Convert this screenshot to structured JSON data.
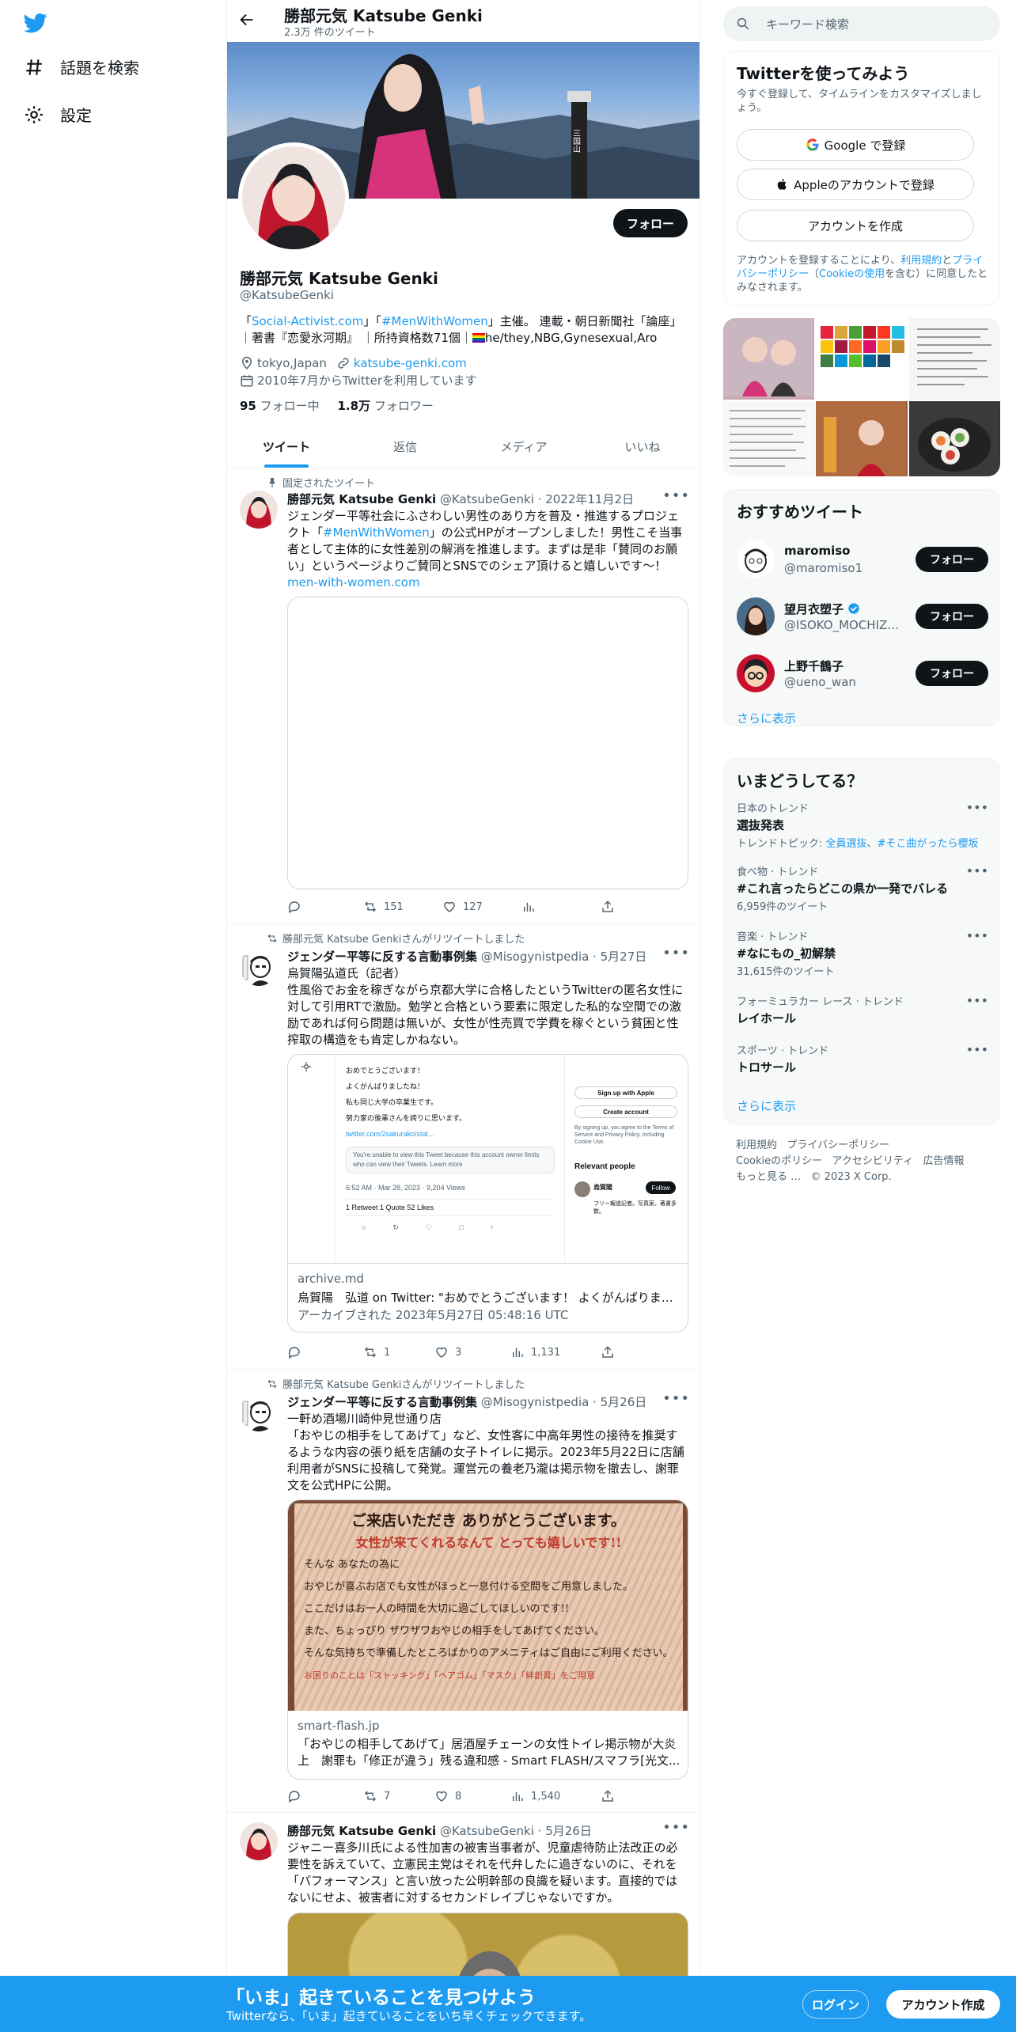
{
  "nav": {
    "explore": "話題を検索",
    "settings": "設定"
  },
  "header": {
    "title": "勝部元気 Katsube Genki",
    "subtitle": "2.3万 件のツイート"
  },
  "banner": {
    "sign_text": "三国山"
  },
  "profile": {
    "follow": "フォロー",
    "name": "勝部元気 Katsube Genki",
    "handle": "@KatsubeGenki",
    "bio_line1_a": "「",
    "bio_link1": "Social-Activist.com",
    "bio_line1_b": "」「",
    "bio_link2": "#MenWithWomen",
    "bio_line1_c": "」主催。 連載・朝日新聞社「論座」",
    "bio_line2": "｜著書『恋愛氷河期』 ｜所持資格数71個｜",
    "bio_line2_b": "he/they,NBG,Gynesexual,Aro",
    "location": "tokyo,Japan",
    "website": "katsube-genki.com",
    "joined": "2010年7月からTwitterを利用しています",
    "following_count": "95",
    "following_label": "フォロー中",
    "followers_count": "1.8万",
    "followers_label": "フォロワー"
  },
  "tabs": [
    "ツイート",
    "返信",
    "メディア",
    "いいね"
  ],
  "tweets": [
    {
      "context": "固定されたツイート",
      "name": "勝部元気 Katsube Genki",
      "handle": "@KatsubeGenki",
      "date": "· 2022年11月2日",
      "text_a": "ジェンダー平等社会にふさわしい男性のあり方を普及・推進するプロジェクト「",
      "text_link": "#MenWithWomen",
      "text_b": "」の公式HPがオープンしました！男性こそ当事者として主体的に女性差別の解消を推進します。まずは是非「賛同のお願い」というページよりご賛同とSNSでのシェア頂けると嬉しいです〜！",
      "url": "men-with-women.com",
      "reply": "",
      "retweets": "151",
      "likes": "127",
      "views": ""
    },
    {
      "context": "勝部元気 Katsube Genkiさんがリツイートしました",
      "name": "ジェンダー平等に反する言動事例集",
      "handle": "@Misogynistpedia",
      "date": "· 5月27日",
      "text": "烏賀陽弘道氏（記者）\n性風俗でお金を稼ぎながら京都大学に合格したというTwitterの匿名女性に対して引用RTで激励。勉学と合格という要素に限定した私的な空間での激励であれば何ら問題は無いが、女性が性売買で学費を稼ぐという貧困と性搾取の構造をも肯定しかねない。",
      "card_domain": "archive.md",
      "card_title": "烏賀陽　弘道 on Twitter: \"おめでとうございます！ よくがんばりまし...",
      "card_sub": "アーカイブされた 2023年5月27日 05:48:16 UTC",
      "shot_lines": [
        "おめでとうございます！",
        "よくがんばりましたね！",
        "私も同じ大学の卒業生です。",
        "努力家の後輩さんを誇りに思います。"
      ],
      "shot_link": "twitter.com/2sakurako/stat...",
      "shot_note": "You're unable to view this Tweet because this account owner limits who can view their Tweets. Learn more",
      "shot_time": "6:52 AM · Mar 28, 2023 · 9,204 Views",
      "shot_stats": "1 Retweet   1 Quote   52 Likes",
      "shot_apple": "Sign up with Apple",
      "shot_create": "Create account",
      "shot_terms": "By signing up, you agree to the Terms of Service and Privacy Policy, including Cookie Use.",
      "shot_relevant": "Relevant people",
      "shot_follow": "Follow",
      "shot_person": "烏賀陽",
      "shot_bio": "フリー報道記者。写真家。著書多数。",
      "retweets": "1",
      "likes": "3",
      "views": "1,131"
    },
    {
      "context": "勝部元気 Katsube Genkiさんがリツイートしました",
      "name": "ジェンダー平等に反する言動事例集",
      "handle": "@Misogynistpedia",
      "date": "· 5月26日",
      "text": "一軒め酒場川崎仲見世通り店\n「おやじの相手をしてあげて」など、女性客に中高年男性の接待を推奨するような内容の張り紙を店舗の女子トイレに掲示。2023年5月22日に店舗利用者がSNSに投稿して発覚。運営元の養老乃瀧は掲示物を撤去し、謝罪文を公式HPに公開。",
      "paper_lines": [
        "ご来店いただき ありがとうございます。",
        "女性が来てくれるなんて とっても嬉しいです!!",
        "そんな あなたの為に",
        "おやじが喜ぶお店でも女性がほっと一息付ける空間をご用意しました。",
        "ここだけはお一人の時間を大切に過ごしてほしいのです!!",
        "また、ちょっぴり ザワザワおやじの相手をしてあげてください。",
        "そんな気持ちで準備したところばかりのアメニティはご自由にご利用ください。",
        "お困りのことは「ストッキング」「ヘアゴム」「マスク」「絆創膏」をご用意"
      ],
      "card_domain": "smart-flash.jp",
      "card_title": "「おやじの相手してあげて」居酒屋チェーンの女性トイレ掲示物が大炎上　謝罪も「修正が違う」残る違和感 - Smart FLASH/スマフラ[光文...",
      "retweets": "7",
      "likes": "8",
      "views": "1,540"
    },
    {
      "name": "勝部元気 Katsube Genki",
      "handle": "@KatsubeGenki",
      "date": "· 5月26日",
      "text": "ジャニー喜多川氏による性加害の被害当事者が、児童虐待防止法改正の必要性を訴えていて、立憲民主党はそれを代弁したに過ぎないのに、それを「パフォーマンス」と言い放った公明幹部の良識を疑います。直接的ではないにせよ、被害者に対するセカンドレイプじゃないですか。"
    }
  ],
  "search": {
    "placeholder": "キーワード検索"
  },
  "signup": {
    "title": "Twitterを使ってみよう",
    "desc": "今すぐ登録して、タイムラインをカスタマイズしましょう。",
    "google": "Google で登録",
    "apple": "Appleのアカウントで登録",
    "create": "アカウントを作成",
    "terms_a": "アカウントを登録することにより、",
    "terms_link1": "利用規約",
    "terms_b": "と",
    "terms_link2": "プライバシーポリシー",
    "terms_c": "（",
    "terms_link3": "Cookieの使用",
    "terms_d": "を含む）に同意したとみなされます。"
  },
  "recommend": {
    "title": "おすすめツイート",
    "users": [
      {
        "name": "maromiso",
        "handle": "@maromiso1",
        "follow": "フォロー"
      },
      {
        "name": "望月衣塑子",
        "handle": "@ISOKO_MOCHIZUKI",
        "follow": "フォロー"
      },
      {
        "name": "上野千鶴子",
        "handle": "@ueno_wan",
        "follow": "フォロー"
      }
    ],
    "more": "さらに表示"
  },
  "trends": {
    "title": "いまどうしてる？",
    "items": [
      {
        "cat": "日本のトレンド",
        "name": "選抜発表",
        "sub_a": "トレンドトピック: ",
        "sub_l1": "全員選抜",
        "sub_b": "、",
        "sub_l2": "#そこ曲がったら櫻坂"
      },
      {
        "cat": "食べ物 · トレンド",
        "name": "#これ言ったらどこの県か一発でバレる",
        "sub": "6,959件のツイート"
      },
      {
        "cat": "音楽 · トレンド",
        "name": "#なにもの_初解禁",
        "sub": "31,615件のツイート"
      },
      {
        "cat": "フォーミュラカー レース · トレンド",
        "name": "レイホール",
        "sub": ""
      },
      {
        "cat": "スポーツ · トレンド",
        "name": "トロサール",
        "sub": ""
      }
    ],
    "more": "さらに表示"
  },
  "footer": [
    "利用規約",
    "プライバシーポリシー",
    "Cookieのポリシー",
    "アクセシビリティ",
    "広告情報",
    "もっと見る …",
    "© 2023 X Corp."
  ],
  "bottom": {
    "title": "「いま」起きていることを見つけよう",
    "sub": "Twitterなら、「いま」起きていることをいち早くチェックできます。",
    "login": "ログイン",
    "signup": "アカウント作成"
  },
  "colors": {
    "accent": "#1d9bf0",
    "text": "#0f1419",
    "muted": "#536471"
  }
}
